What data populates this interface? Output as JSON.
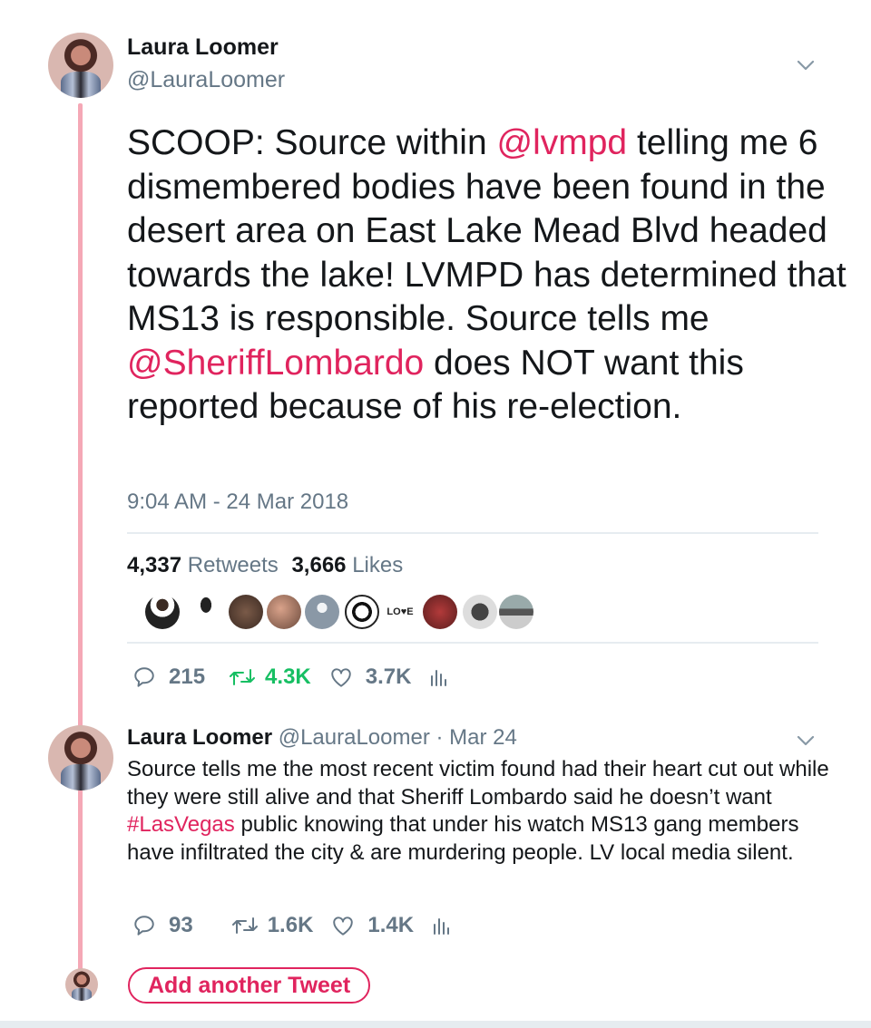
{
  "thread": {
    "author": {
      "name": "Laura Loomer",
      "handle": "@LauraLoomer"
    },
    "main_tweet": {
      "text_parts": [
        {
          "t": "SCOOP: Source within ",
          "link": false
        },
        {
          "t": "@lvmpd",
          "link": true
        },
        {
          "t": " telling me 6 dismembered bodies have been found in the desert area on East Lake Mead Blvd headed towards the lake! LVMPD has determined that MS13 is responsible. Source tells me ",
          "link": false
        },
        {
          "t": "@SheriffLombardo",
          "link": true
        },
        {
          "t": " does NOT want this reported because of his re-election.",
          "link": false
        }
      ],
      "timestamp": "9:04 AM - 24 Mar 2018",
      "retweets_count": "4,337",
      "retweets_label": "Retweets",
      "likes_count": "3,666",
      "likes_label": "Likes",
      "liker_love_text": "LO♥E",
      "actions": {
        "replies": "215",
        "retweets": "4.3K",
        "likes": "3.7K"
      }
    },
    "reply_tweet": {
      "name": "Laura Loomer",
      "meta": "@LauraLoomer · Mar 24",
      "text_parts": [
        {
          "t": "Source tells me the most recent victim found had their heart cut out while they were still alive and that Sheriff Lombardo said he doesn’t want ",
          "link": false
        },
        {
          "t": "#LasVegas",
          "link": true
        },
        {
          "t": " public knowing that under his watch MS13 gang members have infiltrated the city & are murdering people. LV local media silent.",
          "link": false
        }
      ],
      "actions": {
        "replies": "93",
        "retweets": "1.6K",
        "likes": "1.4K"
      }
    },
    "add_button_label": "Add another Tweet"
  },
  "colors": {
    "accent": "#e0245e",
    "retweet_active": "#17bf63",
    "muted": "#657786",
    "thread_line": "#f5a8b6"
  }
}
